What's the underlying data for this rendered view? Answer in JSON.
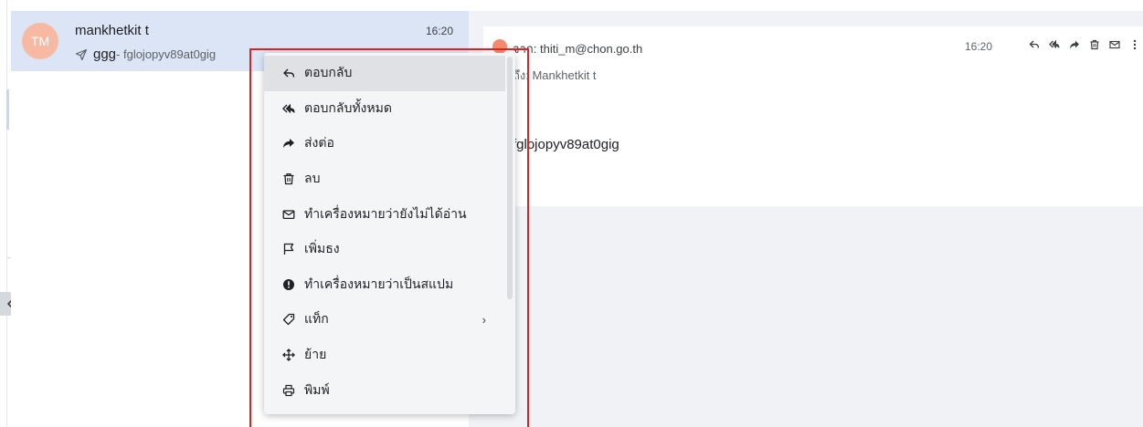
{
  "colors": {
    "selected_row": "#dbe5f6",
    "avatar": "#f7b9a2",
    "annotation": "#e3201f",
    "pane_bg": "#f0f2f5"
  },
  "message": {
    "avatar_initials": "TM",
    "sender": "mankhetkit t",
    "time": "16:20",
    "subject": "ggg",
    "preview": " - fglojopyv89at0gig"
  },
  "detail": {
    "from_prefix": "จาก: ",
    "from_email": "thiti_m@chon.go.th",
    "to_prefix": "ถึง: ",
    "to_name": "Mankhetkit t",
    "time": "16:20",
    "body": "fglojopyv89at0gig",
    "actions": [
      "reply-icon",
      "reply-all-icon",
      "forward-icon",
      "trash-icon",
      "mail-icon",
      "more-vert-icon"
    ]
  },
  "context_menu": {
    "items": [
      {
        "label": "ตอบกลับ",
        "icon": "reply-icon"
      },
      {
        "label": "ตอบกลับทั้งหมด",
        "icon": "reply-all-icon"
      },
      {
        "label": "ส่งต่อ",
        "icon": "forward-icon"
      },
      {
        "label": "ลบ",
        "icon": "trash-icon"
      },
      {
        "label": "ทำเครื่องหมายว่ายังไม่ได้อ่าน",
        "icon": "mail-icon"
      },
      {
        "label": "เพิ่มธง",
        "icon": "flag-icon"
      },
      {
        "label": "ทำเครื่องหมายว่าเป็นสแปม",
        "icon": "spam-icon"
      },
      {
        "label": "แท็ก",
        "icon": "tag-icon",
        "submenu": "›"
      },
      {
        "label": "ย้าย",
        "icon": "move-icon"
      },
      {
        "label": "พิมพ์",
        "icon": "print-icon"
      }
    ]
  }
}
